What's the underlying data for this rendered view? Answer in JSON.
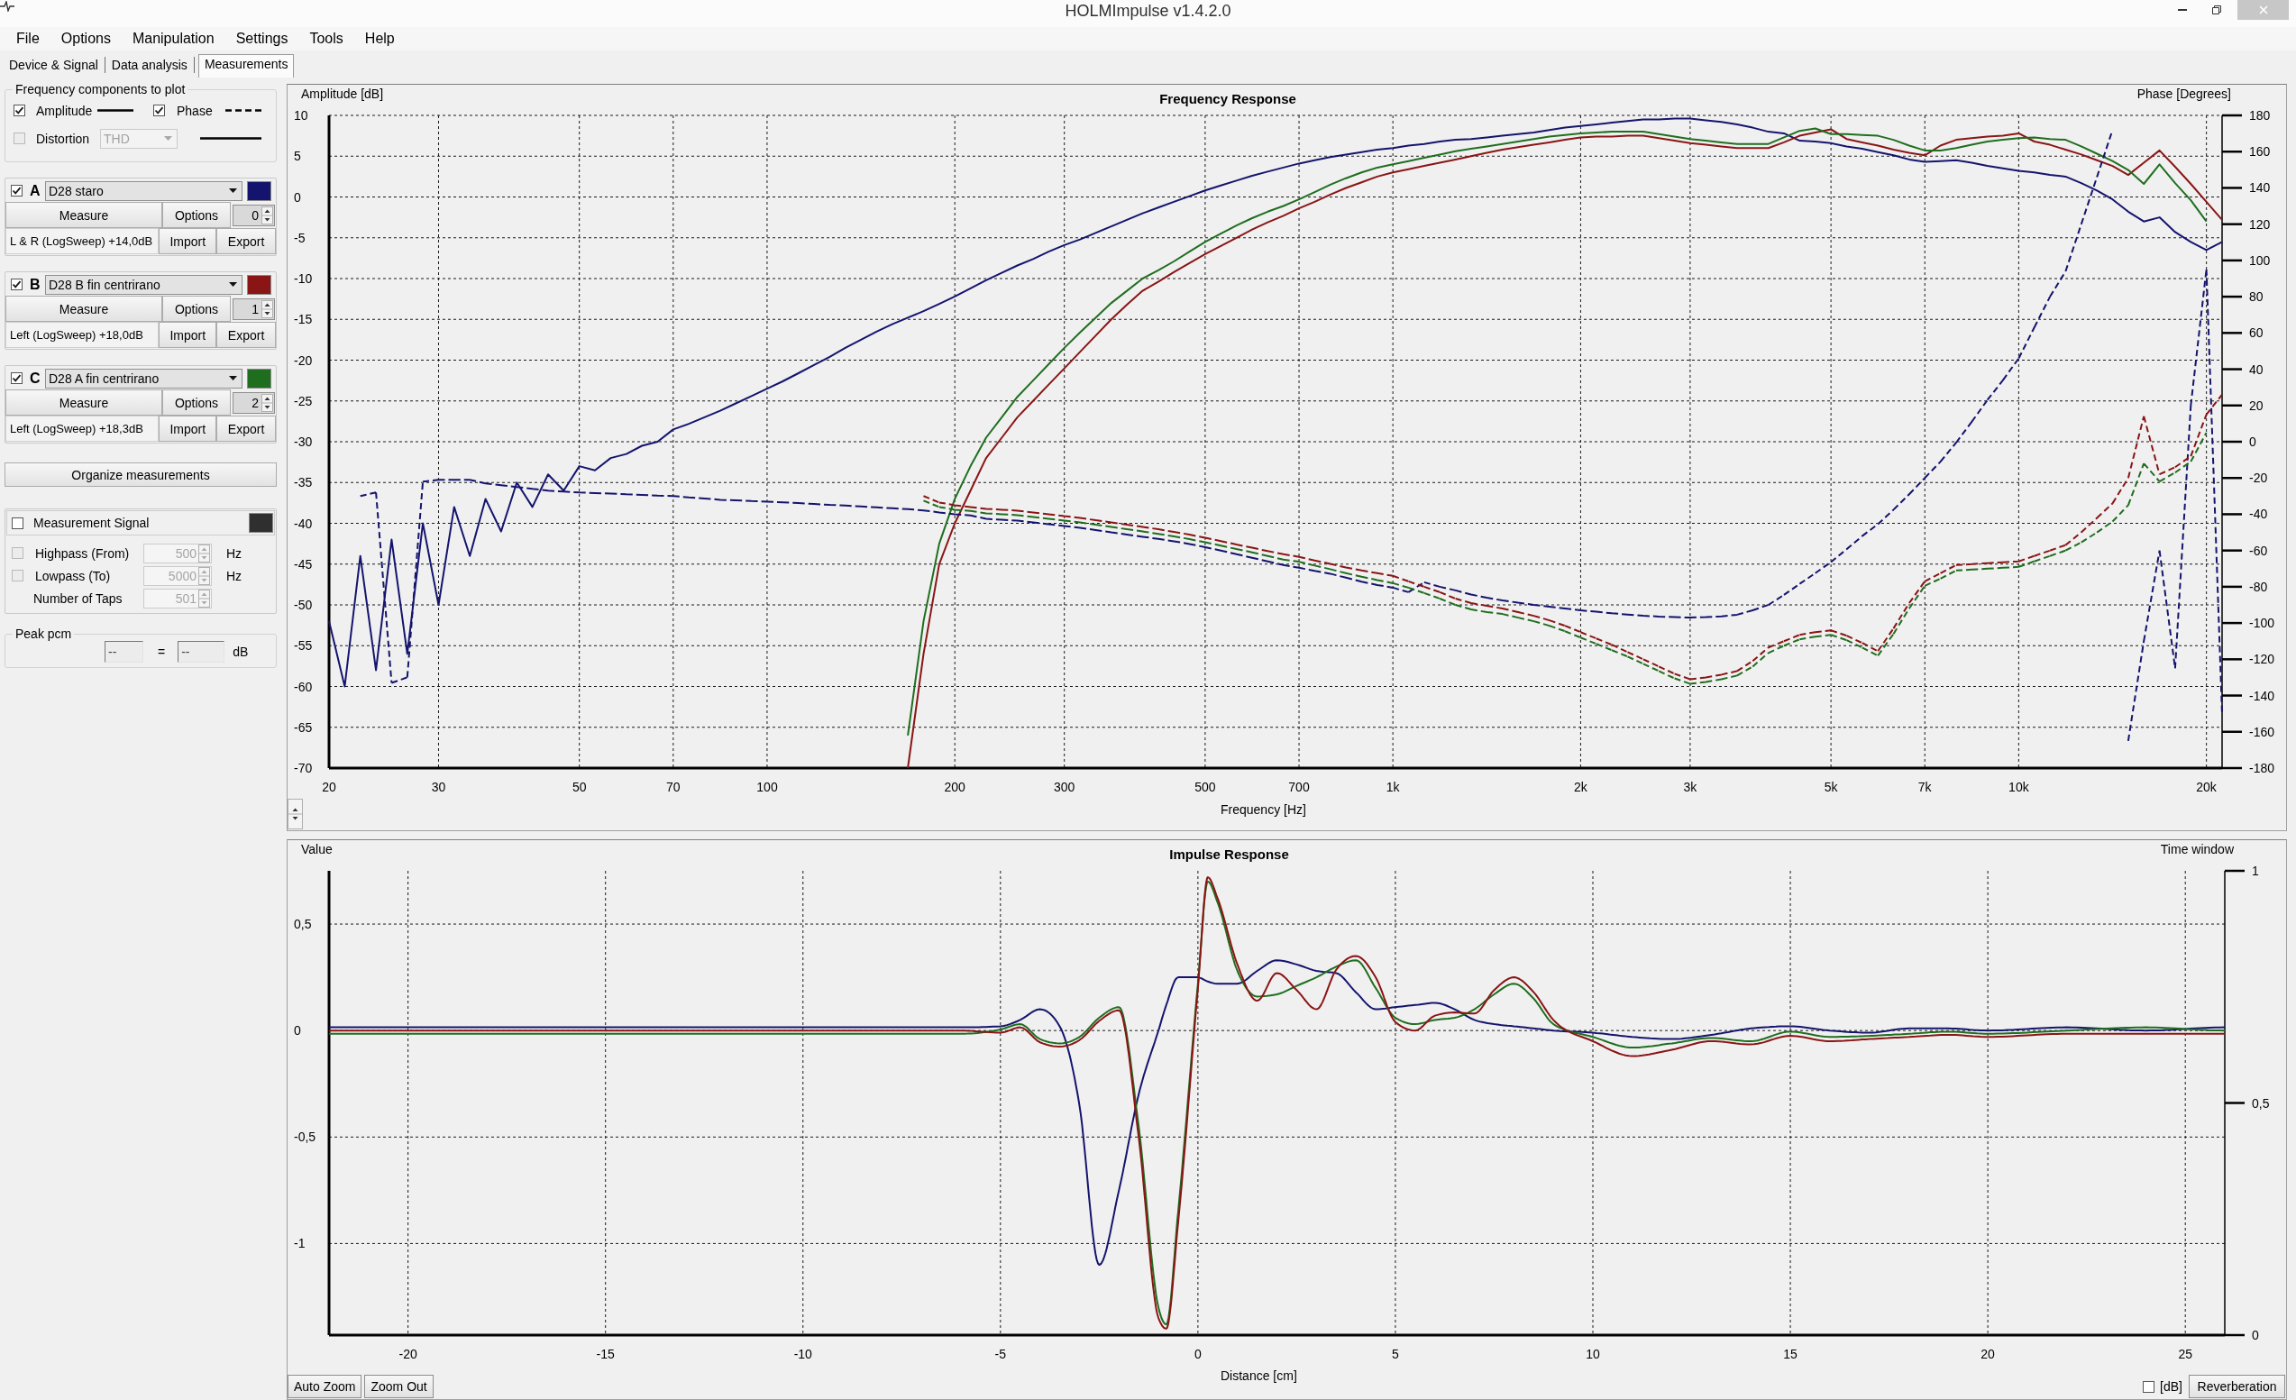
{
  "window": {
    "title": "HOLMImpulse v1.4.2.0"
  },
  "menu": [
    "File",
    "Options",
    "Manipulation",
    "Settings",
    "Tools",
    "Help"
  ],
  "tabs": [
    {
      "label": "Device & Signal",
      "selected": false
    },
    {
      "label": "Data analysis",
      "selected": false
    },
    {
      "label": "Measurements",
      "selected": true
    }
  ],
  "plot_components": {
    "title": "Frequency components to plot",
    "amplitude": {
      "label": "Amplitude",
      "checked": true,
      "dashed": false
    },
    "phase": {
      "label": "Phase",
      "checked": true,
      "dashed": true
    },
    "distortion": {
      "label": "Distortion",
      "checked": false,
      "disabled": true,
      "mode": "THD",
      "dashed": false
    }
  },
  "measurements": [
    {
      "letter": "A",
      "checked": true,
      "name": "D28 staro",
      "color": "#14146e",
      "measure": "Measure",
      "options": "Options",
      "index": "0",
      "info": "L & R (LogSweep) +14,0dB",
      "import": "Import",
      "export": "Export"
    },
    {
      "letter": "B",
      "checked": true,
      "name": "D28 B fin centrirano",
      "color": "#8a1515",
      "measure": "Measure",
      "options": "Options",
      "index": "1",
      "info": "Left (LogSweep) +18,0dB",
      "import": "Import",
      "export": "Export"
    },
    {
      "letter": "C",
      "checked": true,
      "name": "D28 A fin centrirano",
      "color": "#1f6e1f",
      "measure": "Measure",
      "options": "Options",
      "index": "2",
      "info": "Left (LogSweep) +18,3dB",
      "import": "Import",
      "export": "Export"
    }
  ],
  "organize_button": "Organize measurements",
  "measurement_signal": {
    "label": "Measurement Signal",
    "checked": false,
    "filters": [
      {
        "kind": "toggle",
        "label": "Highpass (From)",
        "checked": false,
        "disabled": true,
        "value": "500",
        "unit": "Hz"
      },
      {
        "kind": "toggle",
        "label": "Lowpass (To)",
        "checked": false,
        "disabled": true,
        "value": "5000",
        "unit": "Hz"
      },
      {
        "kind": "plain",
        "label": "Number of Taps",
        "disabled": true,
        "value": "501"
      }
    ]
  },
  "peak": {
    "title": "Peak pcm",
    "value_left": "--",
    "separator": "=",
    "value_right": "--",
    "unit": "dB"
  },
  "frequency_response": {
    "chart_data": {
      "type": "line",
      "title": "Frequency Response",
      "xlabel": "Frequency [Hz]",
      "ylabel": "Amplitude [dB]",
      "y2label": "Phase [Degrees]",
      "categories": [
        "20",
        null,
        null,
        null,
        null,
        null,
        null,
        "30",
        null,
        null,
        null,
        null,
        null,
        null,
        null,
        null,
        "50",
        null,
        null,
        null,
        null,
        null,
        "70",
        null,
        null,
        null,
        null,
        null,
        "100",
        null,
        null,
        null,
        null,
        null,
        null,
        null,
        null,
        null,
        null,
        null,
        "200",
        null,
        null,
        null,
        null,
        null,
        null,
        "300",
        null,
        null,
        null,
        null,
        null,
        null,
        null,
        null,
        "500",
        null,
        null,
        null,
        null,
        null,
        "700",
        null,
        null,
        null,
        null,
        null,
        "1k",
        null,
        null,
        null,
        null,
        null,
        null,
        null,
        null,
        null,
        null,
        null,
        "2k",
        null,
        null,
        null,
        null,
        null,
        null,
        "3k",
        null,
        null,
        null,
        null,
        null,
        null,
        null,
        null,
        "5k",
        null,
        null,
        null,
        null,
        null,
        "7k",
        null,
        null,
        null,
        null,
        null,
        "10k",
        null,
        null,
        null,
        null,
        null,
        null,
        null,
        null,
        null,
        null,
        null,
        "20k",
        null
      ],
      "series": [
        {
          "color": "#14146e",
          "values": [
            -52,
            -60,
            -44,
            -58,
            -42,
            -56,
            -40,
            -50,
            -38,
            -44,
            -37,
            -41,
            -35,
            -38,
            -34,
            -36,
            -33,
            -33.5,
            -32,
            -31.5,
            -30.5,
            -30,
            -28.5,
            -27.8,
            -27,
            -26.2,
            -25.3,
            -24.4,
            -23.5,
            -22.6,
            -21.6,
            -20.6,
            -19.6,
            -18.5,
            -17.5,
            -16.5,
            -15.6,
            -14.8,
            -14,
            -13.1,
            -12.2,
            -11.2,
            -10.2,
            -9.3,
            -8.4,
            -7.6,
            -6.7,
            -5.9,
            -5.2,
            -4.4,
            -3.6,
            -2.8,
            -2,
            -1.3,
            -0.6,
            0.1,
            0.8,
            1.4,
            2,
            2.6,
            3.1,
            3.6,
            4.1,
            4.5,
            4.9,
            5.2,
            5.5,
            5.8,
            6,
            6.3,
            6.5,
            6.8,
            7,
            7.1,
            7.3,
            7.5,
            7.7,
            7.9,
            8.2,
            8.5,
            8.7,
            8.9,
            9.1,
            9.3,
            9.5,
            9.5,
            9.6,
            9.6,
            9.4,
            9.2,
            8.9,
            8.5,
            8,
            7.8,
            6.9,
            6.8,
            6.6,
            6.2,
            5.9,
            5.5,
            5.1,
            4.6,
            4.3,
            4.4,
            4.5,
            4.2,
            3.8,
            3.5,
            3.2,
            3,
            2.7,
            2.5,
            1.7,
            0.8,
            -0.3,
            -1.8,
            -3,
            -2.5,
            -4.3,
            -5.5,
            -6.5,
            -5.5
          ]
        },
        {
          "color": "#8a1515",
          "values": [
            null,
            null,
            null,
            null,
            null,
            null,
            null,
            null,
            null,
            null,
            null,
            null,
            null,
            null,
            null,
            null,
            null,
            null,
            null,
            null,
            null,
            null,
            null,
            null,
            null,
            null,
            null,
            null,
            null,
            null,
            null,
            null,
            null,
            null,
            null,
            null,
            null,
            -70,
            -56,
            -45,
            -40,
            -36,
            -32,
            -29.5,
            -27,
            -25,
            -23,
            -21,
            -19,
            -17,
            -15,
            -13.2,
            -11.5,
            -10.4,
            -9.2,
            -8.1,
            -7,
            -6,
            -5,
            -4,
            -3.1,
            -2.3,
            -1.4,
            -0.6,
            0.3,
            1.1,
            1.8,
            2.5,
            3,
            3.4,
            3.8,
            4.2,
            4.6,
            5,
            5.4,
            5.8,
            6.1,
            6.4,
            6.7,
            7,
            7.3,
            7.4,
            7.4,
            7.5,
            7.5,
            7.2,
            6.9,
            6.6,
            6.4,
            6.2,
            6,
            6,
            6,
            6.7,
            7.5,
            7.9,
            8.3,
            7.1,
            6.7,
            6.3,
            5.8,
            5.4,
            5.1,
            6.3,
            7,
            7.2,
            7.4,
            7.5,
            7.8,
            6.8,
            6.4,
            5.8,
            5.2,
            4.5,
            3.8,
            2.7,
            4.2,
            5.7,
            3.7,
            1.6,
            -0.6,
            -2.8
          ]
        },
        {
          "color": "#1f6e1f",
          "values": [
            null,
            null,
            null,
            null,
            null,
            null,
            null,
            null,
            null,
            null,
            null,
            null,
            null,
            null,
            null,
            null,
            null,
            null,
            null,
            null,
            null,
            null,
            null,
            null,
            null,
            null,
            null,
            null,
            null,
            null,
            null,
            null,
            null,
            null,
            null,
            null,
            null,
            -66,
            -52,
            -42.5,
            -37,
            -33,
            -29.5,
            -27,
            -24.5,
            -22.5,
            -20.5,
            -18.5,
            -16.6,
            -14.8,
            -13,
            -11.5,
            -10,
            -9,
            -7.9,
            -6.7,
            -5.5,
            -4.5,
            -3.5,
            -2.6,
            -1.8,
            -1.1,
            -0.3,
            0.6,
            1.5,
            2.3,
            3,
            3.6,
            4,
            4.4,
            4.8,
            5.2,
            5.6,
            5.9,
            6.2,
            6.5,
            6.8,
            7.1,
            7.4,
            7.6,
            7.8,
            7.9,
            8,
            8,
            8,
            7.7,
            7.4,
            7.1,
            6.9,
            6.7,
            6.5,
            6.5,
            6.5,
            7.3,
            8.1,
            8.4,
            7.7,
            7.7,
            7.6,
            7.5,
            7,
            6.3,
            5.7,
            5.7,
            6,
            6.4,
            6.8,
            7,
            7.2,
            7.3,
            7.1,
            7,
            6.2,
            5.3,
            4.4,
            3.3,
            1.6,
            4,
            1.7,
            -0.4,
            -3,
            null
          ]
        },
        {
          "axis": "y2",
          "line_style": "dashed",
          "color": "#14146e",
          "values": [
            null,
            null,
            -30,
            -28,
            -133,
            -130,
            -22,
            -21,
            -21,
            -21,
            -23,
            -24,
            -25,
            -26,
            -27,
            -27.5,
            -28,
            -28.3,
            -28.6,
            -29,
            -29.3,
            -29.7,
            -30,
            -30.7,
            -31.3,
            -32,
            -32.3,
            -32.7,
            -33,
            -33.4,
            -33.8,
            -34.3,
            -34.8,
            -35.2,
            -35.7,
            -36.2,
            -36.7,
            -37.2,
            -37.9,
            -39,
            -40,
            -40.6,
            -42.5,
            -43,
            -43.5,
            -44.5,
            -45.5,
            -46.5,
            -47.5,
            -48.7,
            -50,
            -51.2,
            -52.4,
            -53.6,
            -54.9,
            -56.4,
            -58.2,
            -60,
            -62,
            -64,
            -66,
            -68,
            -69.5,
            -71.2,
            -72.8,
            -75,
            -77.2,
            -79,
            -80.5,
            -83,
            -77.5,
            -80,
            -82,
            -84.3,
            -86,
            -87.5,
            -88.8,
            -90,
            -91,
            -92,
            -93,
            -93.8,
            -94.6,
            -95.3,
            -96,
            -96.4,
            -96.7,
            -97,
            -96.7,
            -96.3,
            -95.4,
            -93,
            -90,
            -84.5,
            -78.4,
            -72.5,
            -66.4,
            -59.3,
            -52,
            -45.5,
            -37.5,
            -29,
            -20,
            -11,
            -0.5,
            11,
            23,
            34,
            46,
            63,
            80,
            94,
            120,
            146,
            172,
            -165,
            -110,
            -60,
            -125,
            20,
            95,
            -150
          ]
        },
        {
          "axis": "y2",
          "line_style": "dashed",
          "color": "#8a1515",
          "values": [
            null,
            null,
            null,
            null,
            null,
            null,
            null,
            null,
            null,
            null,
            null,
            null,
            null,
            null,
            null,
            null,
            null,
            null,
            null,
            null,
            null,
            null,
            null,
            null,
            null,
            null,
            null,
            null,
            null,
            null,
            null,
            null,
            null,
            null,
            null,
            null,
            null,
            null,
            -30,
            -33.5,
            -35,
            -36,
            -37,
            -37.5,
            -38,
            -39,
            -40,
            -41,
            -42,
            -43.3,
            -44.5,
            -45.8,
            -47,
            -48.3,
            -49.7,
            -51.2,
            -53,
            -54.8,
            -56.7,
            -58.5,
            -60.3,
            -62,
            -63.5,
            -65.5,
            -67.4,
            -69.3,
            -71,
            -72.5,
            -74,
            -77,
            -80,
            -83,
            -86.5,
            -89,
            -90.5,
            -92,
            -94,
            -96,
            -98.5,
            -101.5,
            -105,
            -108.5,
            -112,
            -116,
            -120,
            -124,
            -128,
            -131,
            -130,
            -128.5,
            -126.5,
            -121,
            -113.5,
            -110,
            -106.5,
            -105,
            -104,
            -107,
            -111,
            -115.5,
            -103,
            -89,
            -77,
            -72.5,
            -68,
            -67.5,
            -67,
            -66.5,
            -66,
            -63,
            -60,
            -57,
            -50,
            -42,
            -34,
            -20,
            14,
            -18,
            -14,
            -8,
            15,
            26
          ]
        },
        {
          "axis": "y2",
          "line_style": "dashed",
          "color": "#1f6e1f",
          "values": [
            null,
            null,
            null,
            null,
            null,
            null,
            null,
            null,
            null,
            null,
            null,
            null,
            null,
            null,
            null,
            null,
            null,
            null,
            null,
            null,
            null,
            null,
            null,
            null,
            null,
            null,
            null,
            null,
            null,
            null,
            null,
            null,
            null,
            null,
            null,
            null,
            null,
            null,
            -32.5,
            -36,
            -37.5,
            -38.2,
            -39.5,
            -40,
            -40.5,
            -41.5,
            -42.5,
            -43.5,
            -44.5,
            -45.8,
            -47,
            -48.3,
            -49.5,
            -50.8,
            -52.2,
            -53.7,
            -55.5,
            -57.3,
            -59.2,
            -61,
            -63,
            -65,
            -66.2,
            -68.3,
            -70.3,
            -72.5,
            -74.5,
            -76.3,
            -78,
            -80.5,
            -83.5,
            -86.5,
            -90,
            -92.5,
            -94,
            -95,
            -97,
            -99,
            -101.5,
            -104.5,
            -108,
            -111.5,
            -115,
            -118.5,
            -122.5,
            -126.5,
            -130.5,
            -133.5,
            -132.5,
            -131,
            -129,
            -124,
            -116.5,
            -112.5,
            -109,
            -107.5,
            -106.5,
            -109.5,
            -113.5,
            -118,
            -106,
            -92,
            -79.5,
            -75.5,
            -71,
            -70.5,
            -70,
            -69.5,
            -69,
            -66,
            -63,
            -60,
            -55.5,
            -50,
            -44,
            -35,
            -12,
            -22,
            -17,
            -11,
            5,
            null
          ]
        }
      ],
      "ylim": [
        -70,
        10
      ],
      "y2lim": [
        -180,
        180
      ],
      "grid": true,
      "yticks": [
        10,
        5,
        0,
        -5,
        -10,
        -15,
        -20,
        -25,
        -30,
        -35,
        -40,
        -45,
        -50,
        -55,
        -60,
        -65,
        -70
      ],
      "y2ticks": [
        180,
        160,
        140,
        120,
        100,
        80,
        60,
        40,
        20,
        0,
        -20,
        -40,
        -60,
        -80,
        -100,
        -120,
        -140,
        -160,
        -180
      ]
    }
  },
  "impulse_response": {
    "chart_data": {
      "type": "line",
      "title": "Impulse Response",
      "xlabel": "Distance [cm]",
      "ylabel": "Value",
      "y2label": "Time window",
      "x": [
        -22,
        -15,
        -10,
        -6,
        -5,
        -4.5,
        -4,
        -3.5,
        -3,
        -2.5,
        -2,
        -1.5,
        -1,
        -0.8,
        -0.5,
        0,
        0.25,
        0.5,
        1,
        1.5,
        2,
        2.5,
        3,
        3.5,
        4,
        4.5,
        5,
        5.5,
        6,
        6.5,
        7,
        7.5,
        8,
        8.5,
        9,
        10,
        11,
        12,
        13,
        14,
        15,
        16,
        17,
        18,
        19,
        20,
        22,
        24,
        26
      ],
      "series": [
        {
          "color": "#14146e",
          "values": [
            0.015,
            0.015,
            0.015,
            0.015,
            0.02,
            0.05,
            0.1,
            0.02,
            -0.35,
            -1.1,
            -0.75,
            -0.3,
            0,
            0.12,
            0.25,
            0.25,
            0.23,
            0.22,
            0.22,
            0.28,
            0.33,
            0.31,
            0.28,
            0.27,
            0.18,
            0.1,
            0.11,
            0.12,
            0.13,
            0.1,
            0.05,
            0.03,
            0.02,
            0.01,
            0,
            -0.01,
            -0.03,
            -0.04,
            -0.02,
            0.01,
            0.02,
            0,
            -0.01,
            0.01,
            0.01,
            0,
            0.015,
            0,
            0.015
          ]
        },
        {
          "color": "#1f6e1f",
          "values": [
            -0.015,
            -0.015,
            -0.015,
            -0.015,
            0.005,
            0.03,
            -0.04,
            -0.06,
            -0.03,
            0.06,
            0.11,
            -0.45,
            -1.3,
            -1.38,
            -0.85,
            0.22,
            0.7,
            0.6,
            0.28,
            0.16,
            0.17,
            0.21,
            0.25,
            0.3,
            0.33,
            0.2,
            0.06,
            0.03,
            0.05,
            0.06,
            0.1,
            0.17,
            0.22,
            0.15,
            0.03,
            -0.03,
            -0.08,
            -0.06,
            -0.035,
            -0.05,
            -0.005,
            -0.03,
            -0.025,
            -0.015,
            -0.005,
            -0.015,
            0,
            0.015,
            0
          ]
        },
        {
          "color": "#8a1515",
          "values": [
            0,
            0,
            0,
            0,
            -0.01,
            0.015,
            -0.055,
            -0.075,
            -0.045,
            0.045,
            0.095,
            -0.5,
            -1.35,
            -1.4,
            -0.9,
            0.2,
            0.72,
            0.62,
            0.31,
            0.14,
            0.27,
            0.19,
            0.1,
            0.285,
            0.35,
            0.25,
            0.04,
            0,
            0.07,
            0.085,
            0.08,
            0.19,
            0.25,
            0.18,
            0.05,
            -0.05,
            -0.12,
            -0.09,
            -0.05,
            -0.065,
            -0.025,
            -0.05,
            -0.04,
            -0.03,
            -0.02,
            -0.03,
            -0.015,
            -0.015,
            -0.015
          ]
        }
      ],
      "xlim": [
        -22,
        26
      ],
      "ylim": [
        -1.43,
        0.75
      ],
      "y2lim": [
        0,
        1
      ],
      "grid": true,
      "xticks": [
        -20,
        -15,
        -10,
        -5,
        0,
        5,
        10,
        15,
        20,
        25
      ],
      "yticks": [
        {
          "value": 0.5,
          "label": "0,5"
        },
        {
          "value": 0,
          "label": "0"
        },
        {
          "value": -0.5,
          "label": "-0,5"
        },
        {
          "value": -1,
          "label": "-1"
        }
      ],
      "y2ticks": [
        {
          "value": 1,
          "label": "1"
        },
        {
          "value": 0.5,
          "label": "0,5"
        },
        {
          "value": 0,
          "label": "0"
        }
      ]
    },
    "buttons": [
      "Auto Zoom",
      "Zoom Out"
    ],
    "db_option": {
      "label": "[dB]",
      "checked": false
    },
    "reverberation_button": "Reverberation"
  }
}
